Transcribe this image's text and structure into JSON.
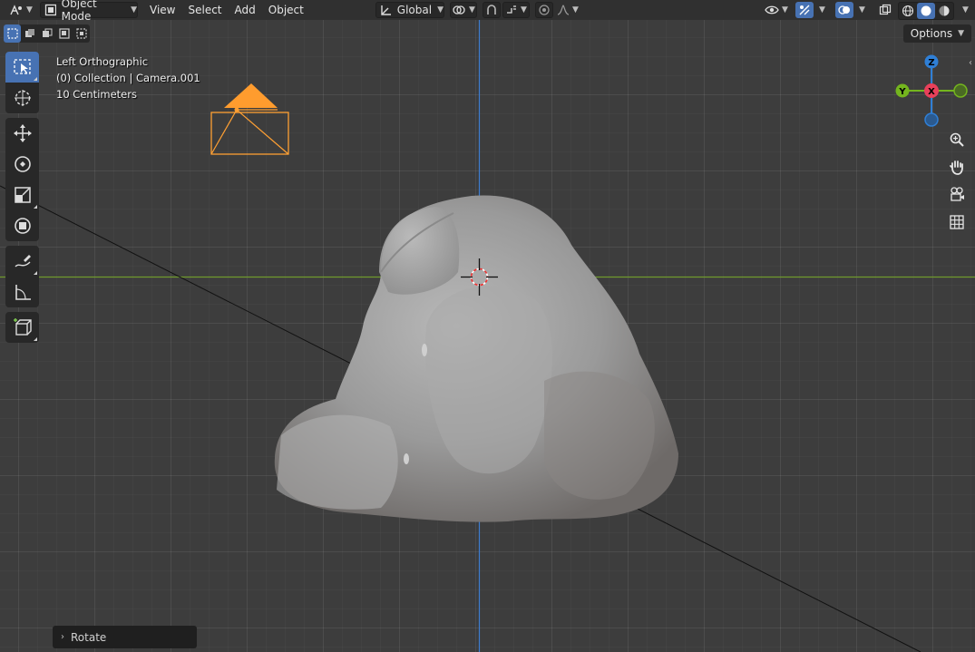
{
  "header": {
    "mode_label": "Object Mode",
    "menu": [
      "View",
      "Select",
      "Add",
      "Object"
    ],
    "transform_orientation": "Global"
  },
  "subheader": {
    "options_label": "Options"
  },
  "overlay": {
    "view_name": "Left Orthographic",
    "collection_info": "(0) Collection | Camera.001",
    "scale_info": "10 Centimeters"
  },
  "gizmo": {
    "z_label": "Z",
    "y_label": "Y",
    "x_label": "X",
    "colors": {
      "z": "#2f7fd6",
      "y": "#74b51e",
      "x": "#e8405a"
    }
  },
  "operator_panel": {
    "label": "Rotate"
  },
  "icons": [
    "editor-type-icon",
    "object-mode-icon",
    "transform-orientation-icon",
    "pivot-icon",
    "snap-icon",
    "proportional-edit-icon",
    "visibility-icon",
    "gizmo-icon",
    "overlay-icon",
    "xray-icon",
    "wireframe-shading-icon",
    "solid-shading-icon",
    "material-shading-icon",
    "select-box-icon",
    "cursor-icon",
    "move-icon",
    "rotate-icon",
    "scale-icon",
    "transform-icon",
    "annotate-icon",
    "measure-icon",
    "add-cube-icon",
    "zoom-icon",
    "pan-hand-icon",
    "camera-view-icon",
    "ortho-grid-icon"
  ],
  "colors": {
    "accent": "#4772b3",
    "camera_selected": "#ffa033",
    "axis_x_line": "#6f9a2e",
    "axis_z_line": "#3d7ccf"
  }
}
